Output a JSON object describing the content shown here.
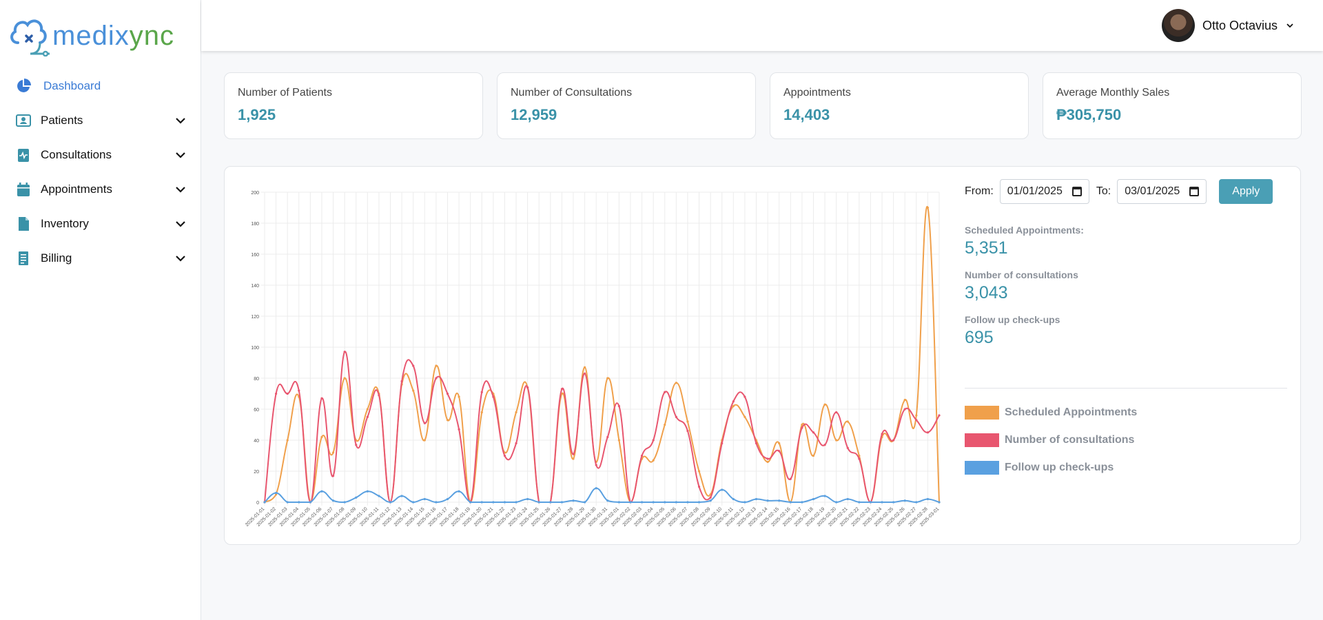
{
  "brand": {
    "logo_prefix": "medix",
    "logo_accent": "ync"
  },
  "sidebar": {
    "items": [
      {
        "label": "Dashboard",
        "icon": "pie-chart-icon",
        "active": true
      },
      {
        "label": "Patients",
        "icon": "patient-card-icon"
      },
      {
        "label": "Consultations",
        "icon": "clipboard-pulse-icon"
      },
      {
        "label": "Appointments",
        "icon": "calendar-icon"
      },
      {
        "label": "Inventory",
        "icon": "document-icon"
      },
      {
        "label": "Billing",
        "icon": "receipt-icon"
      }
    ]
  },
  "header": {
    "user_name": "Otto Octavius"
  },
  "cards": [
    {
      "title": "Number of Patients",
      "value": "1,925"
    },
    {
      "title": "Number of Consultations",
      "value": "12,959"
    },
    {
      "title": "Appointments",
      "value": "14,403"
    },
    {
      "title": "Average Monthly Sales",
      "value": "₱305,750"
    }
  ],
  "filters": {
    "from_label": "From:",
    "from_value": "01/01/2025",
    "to_label": "To:",
    "to_value": "03/01/2025",
    "apply_label": "Apply"
  },
  "stats": [
    {
      "label": "Scheduled Appointments:",
      "value": "5,351"
    },
    {
      "label": "Number of consultations",
      "value": "3,043"
    },
    {
      "label": "Follow up check-ups",
      "value": "695"
    }
  ],
  "colors": {
    "accent": "#3a92a8",
    "scheduled": "#f0a04b",
    "consultations": "#e8566f",
    "followup": "#5aa0e0"
  },
  "chart_data": {
    "type": "line",
    "ylim": [
      0,
      200
    ],
    "yticks": [
      0,
      20,
      40,
      60,
      80,
      100,
      120,
      140,
      160,
      180,
      200
    ],
    "x": [
      "2025-01-01",
      "2025-01-02",
      "2025-01-03",
      "2025-01-04",
      "2025-01-05",
      "2025-01-06",
      "2025-01-07",
      "2025-01-08",
      "2025-01-09",
      "2025-01-10",
      "2025-01-11",
      "2025-01-12",
      "2025-01-13",
      "2025-01-14",
      "2025-01-15",
      "2025-01-16",
      "2025-01-17",
      "2025-01-18",
      "2025-01-19",
      "2025-01-20",
      "2025-01-21",
      "2025-01-22",
      "2025-01-23",
      "2025-01-24",
      "2025-01-25",
      "2025-01-26",
      "2025-01-27",
      "2025-01-28",
      "2025-01-29",
      "2025-01-30",
      "2025-01-31",
      "2025-02-01",
      "2025-02-02",
      "2025-02-03",
      "2025-02-04",
      "2025-02-05",
      "2025-02-06",
      "2025-02-07",
      "2025-02-08",
      "2025-02-09",
      "2025-02-10",
      "2025-02-11",
      "2025-02-12",
      "2025-02-13",
      "2025-02-14",
      "2025-02-15",
      "2025-02-16",
      "2025-02-17",
      "2025-02-18",
      "2025-02-19",
      "2025-02-20",
      "2025-02-21",
      "2025-02-22",
      "2025-02-23",
      "2025-02-24",
      "2025-02-25",
      "2025-02-26",
      "2025-02-27",
      "2025-02-28",
      "2025-03-01"
    ],
    "series": [
      {
        "name": "Scheduled Appointments",
        "color": "#f0a04b",
        "values": [
          0,
          5,
          40,
          68,
          0,
          42,
          32,
          80,
          40,
          60,
          70,
          0,
          76,
          72,
          40,
          88,
          53,
          68,
          0,
          58,
          70,
          32,
          58,
          74,
          0,
          0,
          70,
          28,
          87,
          26,
          80,
          40,
          0,
          28,
          27,
          50,
          77,
          52,
          20,
          5,
          40,
          62,
          55,
          40,
          26,
          38,
          0,
          50,
          30,
          63,
          40,
          52,
          30,
          0,
          42,
          40,
          66,
          56,
          190,
          0
        ]
      },
      {
        "name": "Number of consultations",
        "color": "#e8566f",
        "values": [
          0,
          70,
          70,
          72,
          0,
          67,
          17,
          97,
          37,
          55,
          69,
          0,
          78,
          88,
          51,
          80,
          70,
          47,
          0,
          71,
          68,
          30,
          38,
          74,
          0,
          0,
          73,
          31,
          83,
          24,
          42,
          62,
          0,
          30,
          40,
          71,
          55,
          46,
          10,
          3,
          38,
          65,
          68,
          38,
          28,
          33,
          15,
          48,
          45,
          37,
          58,
          35,
          28,
          0,
          44,
          40,
          60,
          53,
          45,
          56
        ]
      },
      {
        "name": "Follow up check-ups",
        "color": "#5aa0e0",
        "values": [
          0,
          6,
          0,
          0,
          0,
          7,
          1,
          0,
          3,
          7,
          4,
          0,
          4,
          0,
          2,
          0,
          2,
          7,
          0,
          0,
          0,
          0,
          0,
          2,
          0,
          0,
          0,
          1,
          0,
          9,
          1,
          0,
          0,
          0,
          0,
          0,
          0,
          0,
          0,
          1,
          8,
          2,
          0,
          2,
          1,
          1,
          0,
          0,
          2,
          4,
          0,
          2,
          0,
          0,
          0,
          0,
          1,
          0,
          2,
          0
        ]
      }
    ]
  }
}
